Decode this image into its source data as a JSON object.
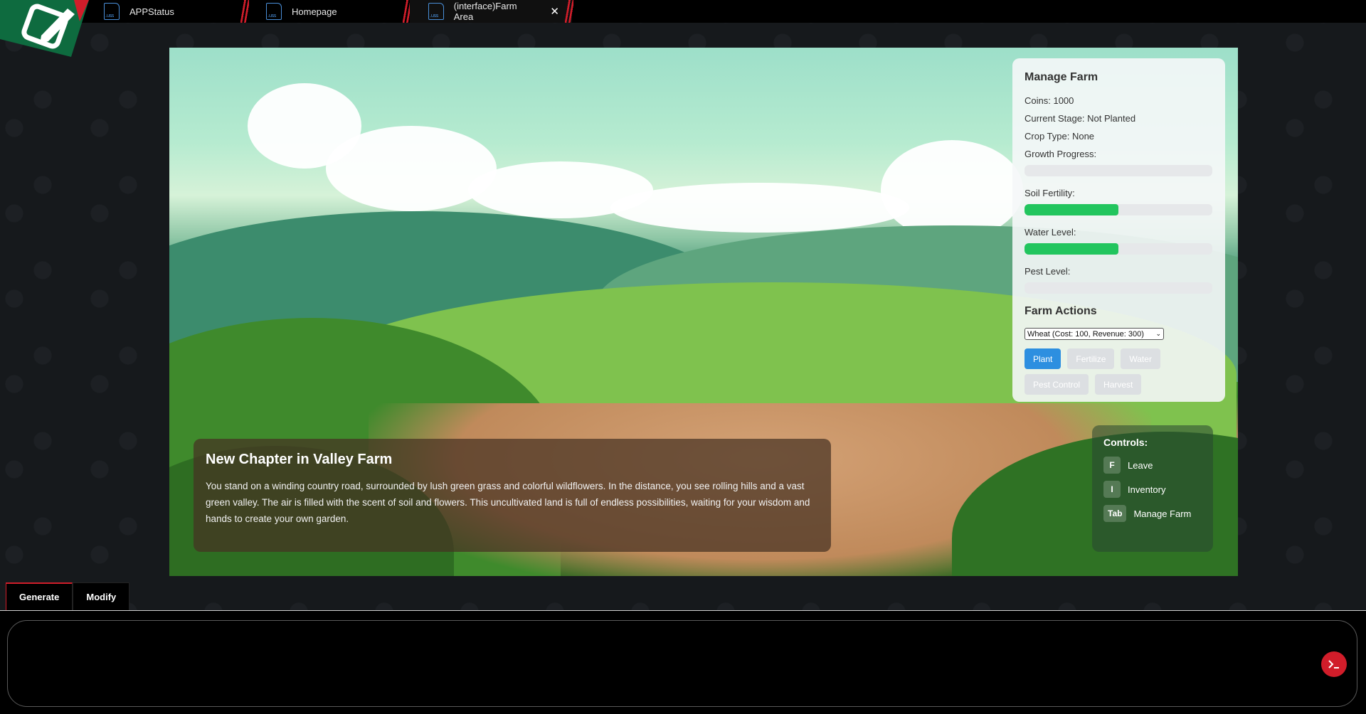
{
  "tabs": [
    {
      "label": "APPStatus",
      "icon": "uss-file-icon"
    },
    {
      "label": "Homepage",
      "icon": "uss-file-icon"
    },
    {
      "label": "(interface)Farm Area",
      "icon": "uss-file-icon",
      "active": true,
      "close": "✕"
    }
  ],
  "file_icon_text": ".uss",
  "manage": {
    "title": "Manage Farm",
    "coins": "Coins: 1000",
    "stage": "Current Stage: Not Planted",
    "crop": "Crop Type: None",
    "growth_label": "Growth Progress:",
    "growth_value": 0,
    "soil_label": "Soil Fertility:",
    "soil_value": 50,
    "water_label": "Water Level:",
    "water_value": 50,
    "pest_label": "Pest Level:",
    "pest_value": 0
  },
  "actions": {
    "title": "Farm Actions",
    "selected_crop": "Wheat (Cost: 100, Revenue: 300)",
    "plant": "Plant",
    "fertilize": "Fertilize",
    "water": "Water",
    "pest": "Pest Control",
    "harvest": "Harvest"
  },
  "story": {
    "title": "New Chapter in Valley Farm",
    "text": "You stand on a winding country road, surrounded by lush green grass and colorful wildflowers. In the distance, you see rolling hills and a vast green valley. The air is filled with the scent of soil and flowers. This uncultivated land is full of endless possibilities, waiting for your wisdom and hands to create your own garden."
  },
  "controls": {
    "title": "Controls:",
    "items": [
      {
        "key": "F",
        "label": "Leave"
      },
      {
        "key": "I",
        "label": "Inventory"
      },
      {
        "key": "Tab",
        "label": "Manage Farm"
      }
    ]
  },
  "mode_tabs": {
    "generate": "Generate",
    "modify": "Modify"
  },
  "colors": {
    "accent": "#d11d2a",
    "progress": "#22c55e",
    "primary_button": "#2d8fe0"
  }
}
